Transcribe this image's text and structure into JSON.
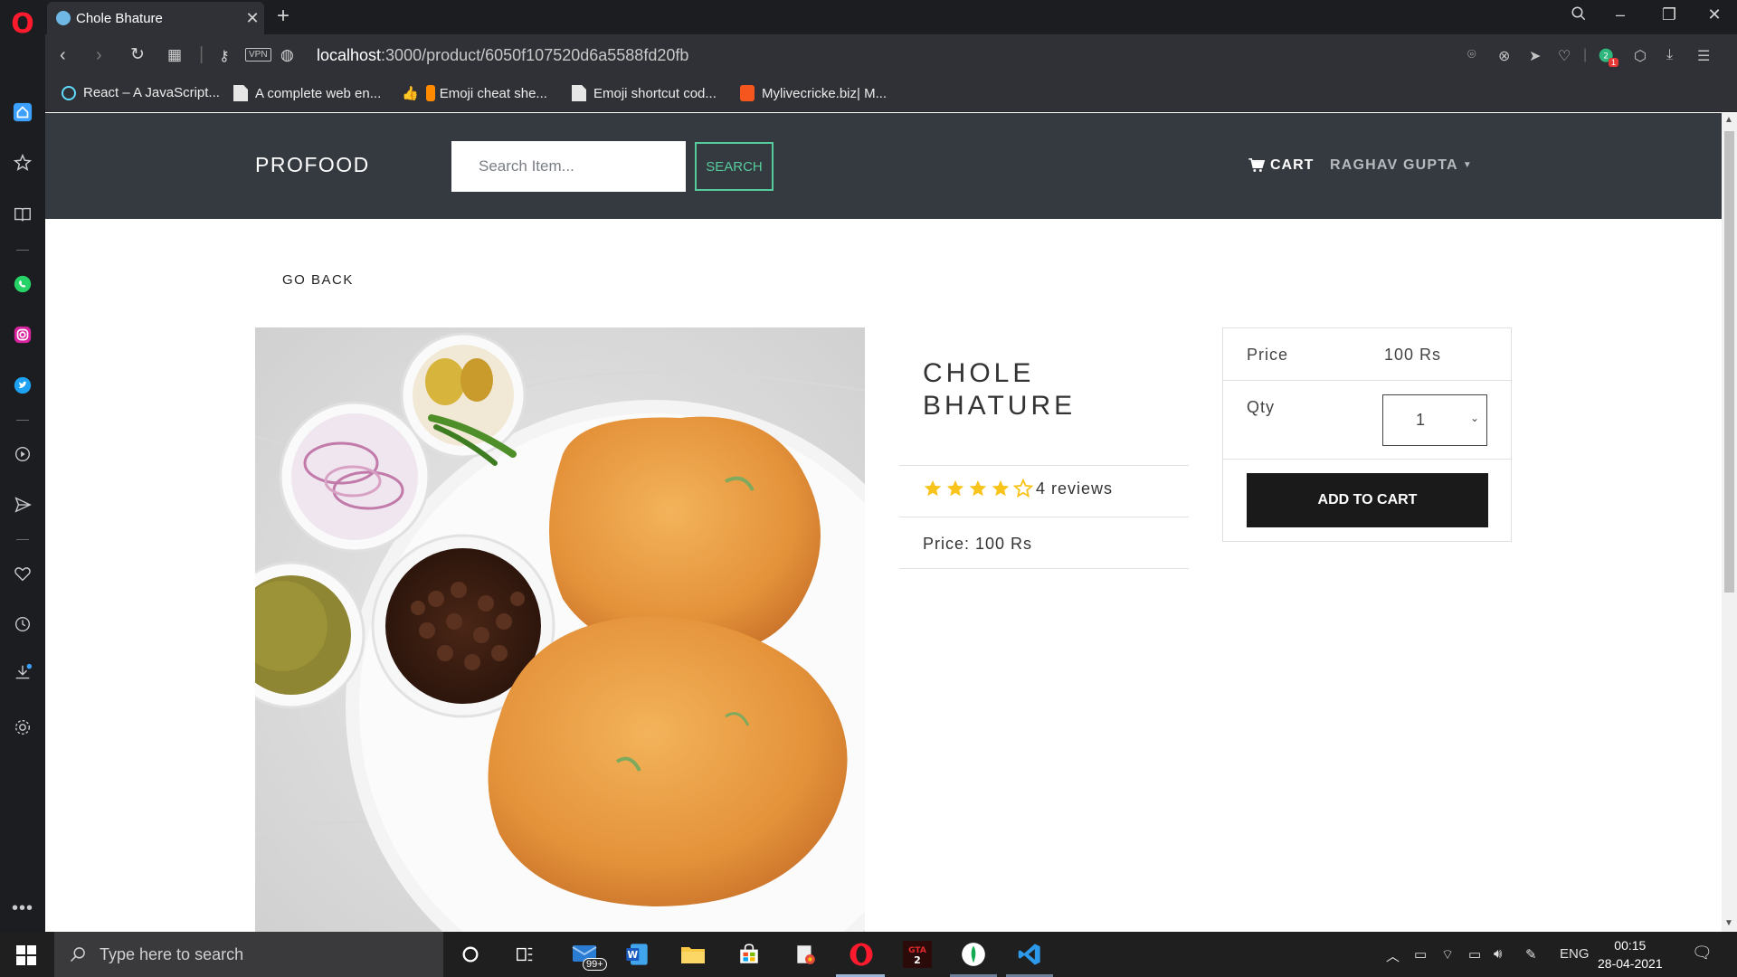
{
  "browser": {
    "tab_title": "Chole Bhature",
    "url_host": "localhost",
    "url_path": ":3000/product/6050f107520d6a5588fd20fb",
    "vpn_label": "VPN",
    "bookmarks": [
      {
        "label": "React – A JavaScript...",
        "icon": "react-icon"
      },
      {
        "label": "A complete web en...",
        "icon": "document-icon"
      },
      {
        "label": "Emoji cheat she...",
        "icon": "thumbs-up-icon"
      },
      {
        "label": "Emoji shortcut cod...",
        "icon": "document-icon"
      },
      {
        "label": "Mylivecricke.biz| M...",
        "icon": "blogger-icon"
      }
    ],
    "notification_badge": "1"
  },
  "navbar": {
    "brand": "PROFOOD",
    "search_placeholder": "Search Item...",
    "search_button": "SEARCH",
    "cart_label": "CART",
    "user_label": "RAGHAV GUPTA"
  },
  "product": {
    "go_back": "GO BACK",
    "title_line1": "CHOLE",
    "title_line2": "BHATURE",
    "rating": 4,
    "rating_max": 5,
    "reviews_text": "4 reviews",
    "price_text": "Price: 100 Rs"
  },
  "purchase_card": {
    "price_label": "Price",
    "price_value": "100 Rs",
    "qty_label": "Qty",
    "qty_value": "1",
    "add_button": "ADD TO CART"
  },
  "taskbar": {
    "search_placeholder": "Type here to search",
    "mail_badge": "99+",
    "language": "ENG",
    "time": "00:15",
    "date": "28-04-2021"
  },
  "colors": {
    "navbar_bg": "#343a40",
    "accent_green": "#56cc9d",
    "star_yellow": "#f8c31a",
    "button_dark": "#1a1a1a"
  }
}
